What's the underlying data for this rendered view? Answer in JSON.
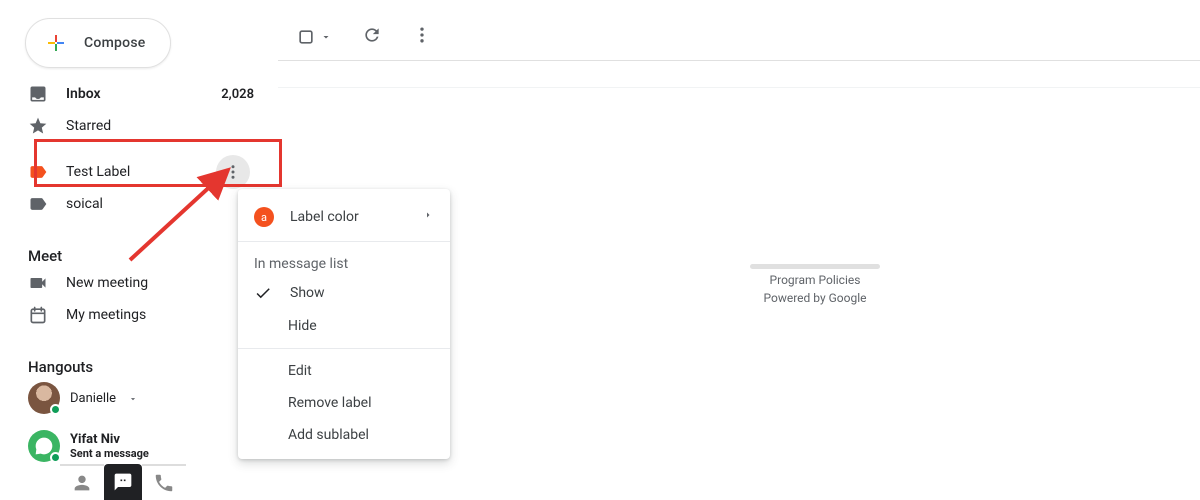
{
  "compose": {
    "label": "Compose"
  },
  "sidebar": {
    "items": [
      {
        "label": "Inbox",
        "count": "2,028"
      },
      {
        "label": "Starred"
      },
      {
        "label": "Test Label"
      },
      {
        "label": "soical"
      }
    ]
  },
  "meet": {
    "header": "Meet",
    "items": [
      {
        "label": "New meeting"
      },
      {
        "label": "My meetings"
      }
    ]
  },
  "hangouts": {
    "header": "Hangouts",
    "contacts": [
      {
        "name": "Danielle"
      },
      {
        "name": "Yifat Niv",
        "sub": "Sent a message"
      }
    ]
  },
  "context_menu": {
    "label_color": "Label color",
    "in_message_list": "In message list",
    "show": "Show",
    "hide": "Hide",
    "edit": "Edit",
    "remove": "Remove label",
    "add_sublabel": "Add sublabel",
    "color_letter": "a"
  },
  "footer": {
    "policies": "Program Policies",
    "powered": "Powered by Google"
  }
}
